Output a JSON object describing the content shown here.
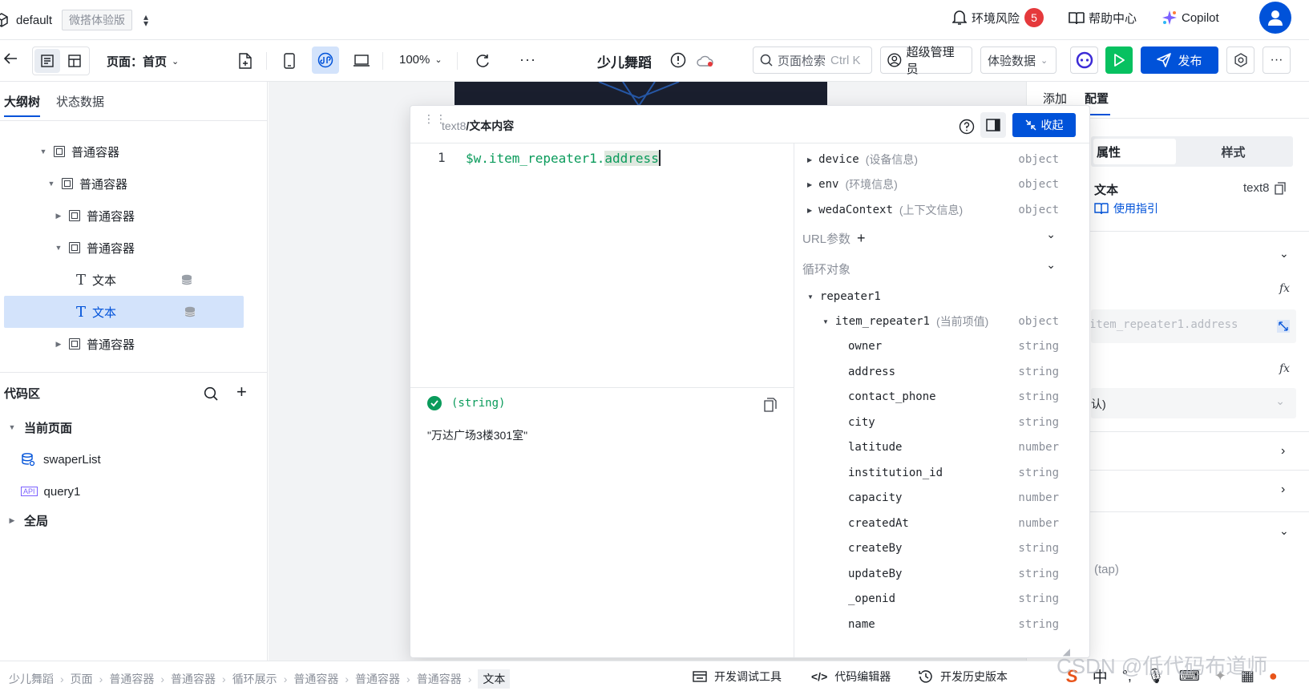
{
  "topbar": {
    "app_name": "default",
    "edition": "微搭体验版",
    "env_risk": "环境风险",
    "env_risk_count": "5",
    "help": "帮助中心",
    "copilot": "Copilot"
  },
  "toolbar": {
    "page_label": "页面：首页",
    "zoom": "100%",
    "app_title": "少儿舞蹈",
    "search_label": "页面检索",
    "search_shortcut": "Ctrl K",
    "admin": "超级管理员",
    "data_mode": "体验数据",
    "publish": "发布"
  },
  "left": {
    "tabs": [
      "大纲树",
      "状态数据"
    ],
    "tree": [
      {
        "label": "普通容器"
      },
      {
        "label": "普通容器"
      },
      {
        "label": "普通容器"
      },
      {
        "label": "普通容器"
      },
      {
        "label": "文本"
      },
      {
        "label": "文本"
      },
      {
        "label": "普通容器"
      }
    ],
    "code_area": "代码区",
    "current_page": "当前页面",
    "code_items": [
      "swaperList",
      "query1"
    ],
    "api_tag": "API",
    "global": "全局"
  },
  "right": {
    "tabs": [
      "添加",
      "配置"
    ],
    "sub_tabs": [
      "属性",
      "样式"
    ],
    "text_label": "文本",
    "component_id": "text8",
    "guide": "使用指引",
    "binding_preview": "item_repeater1.address",
    "select_value": "认)",
    "event_hint": "(tap)"
  },
  "modal": {
    "breadcrumb_id": "text8",
    "breadcrumb_title": "/文本内容",
    "collapse": "收起",
    "line_number": "1",
    "code_prefix": "$w.item_repeater1.",
    "code_highlight": "address",
    "result_type": "(string)",
    "result_value": "\"万达广场3楼301室\"",
    "top_vars": [
      {
        "name": "device",
        "desc": "(设备信息)",
        "type": "object"
      },
      {
        "name": "env",
        "desc": "(环境信息)",
        "type": "object"
      },
      {
        "name": "wedaContext",
        "desc": "(上下文信息)",
        "type": "object"
      }
    ],
    "url_params": "URL参数",
    "loop_objects": "循环对象",
    "repeater": "repeater1",
    "item_repeater": {
      "name": "item_repeater1",
      "desc": "(当前项值)",
      "type": "object"
    },
    "fields": [
      {
        "name": "owner",
        "type": "string"
      },
      {
        "name": "address",
        "type": "string"
      },
      {
        "name": "contact_phone",
        "type": "string"
      },
      {
        "name": "city",
        "type": "string"
      },
      {
        "name": "latitude",
        "type": "number"
      },
      {
        "name": "institution_id",
        "type": "string"
      },
      {
        "name": "capacity",
        "type": "number"
      },
      {
        "name": "createdAt",
        "type": "number"
      },
      {
        "name": "createBy",
        "type": "string"
      },
      {
        "name": "updateBy",
        "type": "string"
      },
      {
        "name": "_openid",
        "type": "string"
      },
      {
        "name": "name",
        "type": "string"
      }
    ]
  },
  "bottom": {
    "breadcrumbs": [
      "少儿舞蹈",
      "页面",
      "普通容器",
      "普通容器",
      "循环展示",
      "普通容器",
      "普通容器",
      "普通容器",
      "文本"
    ],
    "debug_tool": "开发调试工具",
    "code_editor": "代码编辑器",
    "history": "开发历史版本",
    "watermark": "CSDN @低代码布道师",
    "ime_char": "中"
  },
  "colors": {
    "primary": "#0052d9",
    "run_green": "#07c160",
    "risk_red": "#e5393c",
    "code_green": "#0a9b5b",
    "selected_bg": "#d3e3fb"
  }
}
